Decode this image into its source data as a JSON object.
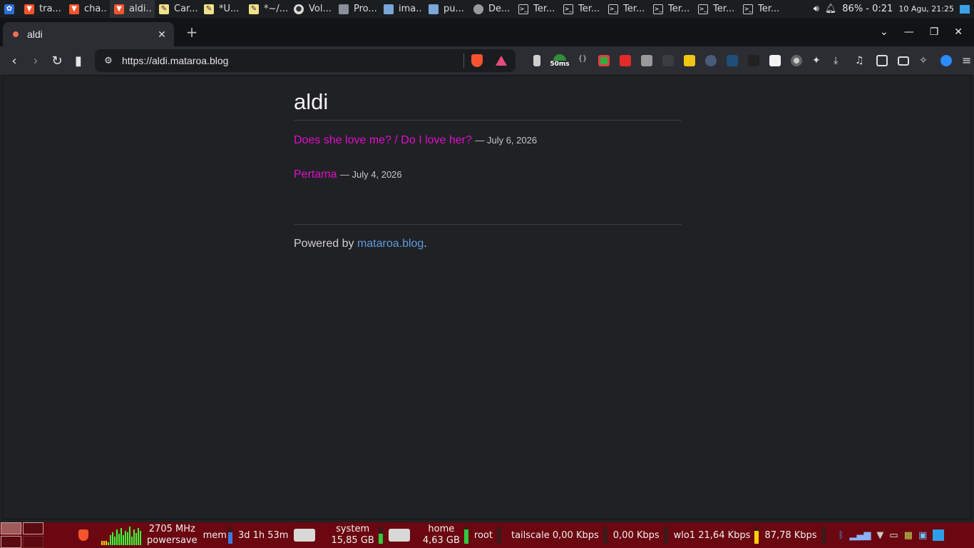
{
  "top_panel": {
    "tasks": [
      {
        "label": "tra...",
        "icon": "brave-icon"
      },
      {
        "label": "cha...",
        "icon": "brave-icon"
      },
      {
        "label": "aldi...",
        "icon": "brave-icon"
      },
      {
        "label": "Car...",
        "icon": "text-editor-icon"
      },
      {
        "label": "*U...",
        "icon": "text-editor-icon"
      },
      {
        "label": "*~/...",
        "icon": "text-editor-icon"
      },
      {
        "label": "Vol...",
        "icon": "volume-app-icon"
      },
      {
        "label": "Pro...",
        "icon": "window-icon"
      },
      {
        "label": "ima...",
        "icon": "folder-icon"
      },
      {
        "label": "pu...",
        "icon": "folder-icon"
      },
      {
        "label": "De...",
        "icon": "app-icon"
      },
      {
        "label": "Ter...",
        "icon": "terminal-icon"
      },
      {
        "label": "Ter...",
        "icon": "terminal-icon"
      },
      {
        "label": "Ter...",
        "icon": "terminal-icon"
      },
      {
        "label": "Ter...",
        "icon": "terminal-icon"
      },
      {
        "label": "Ter...",
        "icon": "terminal-icon"
      },
      {
        "label": "Ter...",
        "icon": "terminal-icon"
      }
    ],
    "battery": "86% - 0:21",
    "clock": "10 Agu, 21:25"
  },
  "browser": {
    "tab_title": "aldi",
    "url": "https://aldi.mataroa.blog",
    "ext_badge": "50ms",
    "accent": "#e10ecc"
  },
  "blog": {
    "title": "aldi",
    "posts": [
      {
        "title": "Does she love me? / Do I love her?",
        "date": "— July 6, 2026"
      },
      {
        "title": "Pertama",
        "date": "— July 4, 2026"
      }
    ],
    "footer_prefix": "Powered by ",
    "footer_link": "mataroa.blog",
    "footer_suffix": "."
  },
  "bottom_panel": {
    "cpu_freq": "2705 MHz",
    "cpu_governor": "powersave",
    "mem_label": "mem",
    "uptime": "3d 1h 53m",
    "disk1_name": "system",
    "disk1_size": "15,85 GB",
    "disk2_name": "home",
    "disk2_size": "4,63 GB",
    "root_label": "root",
    "tailscale": "tailscale 0,00 Kbps",
    "net2": "0,00 Kbps",
    "wlo1": "wlo1 21,64 Kbps",
    "net3": "87,78 Kbps"
  }
}
